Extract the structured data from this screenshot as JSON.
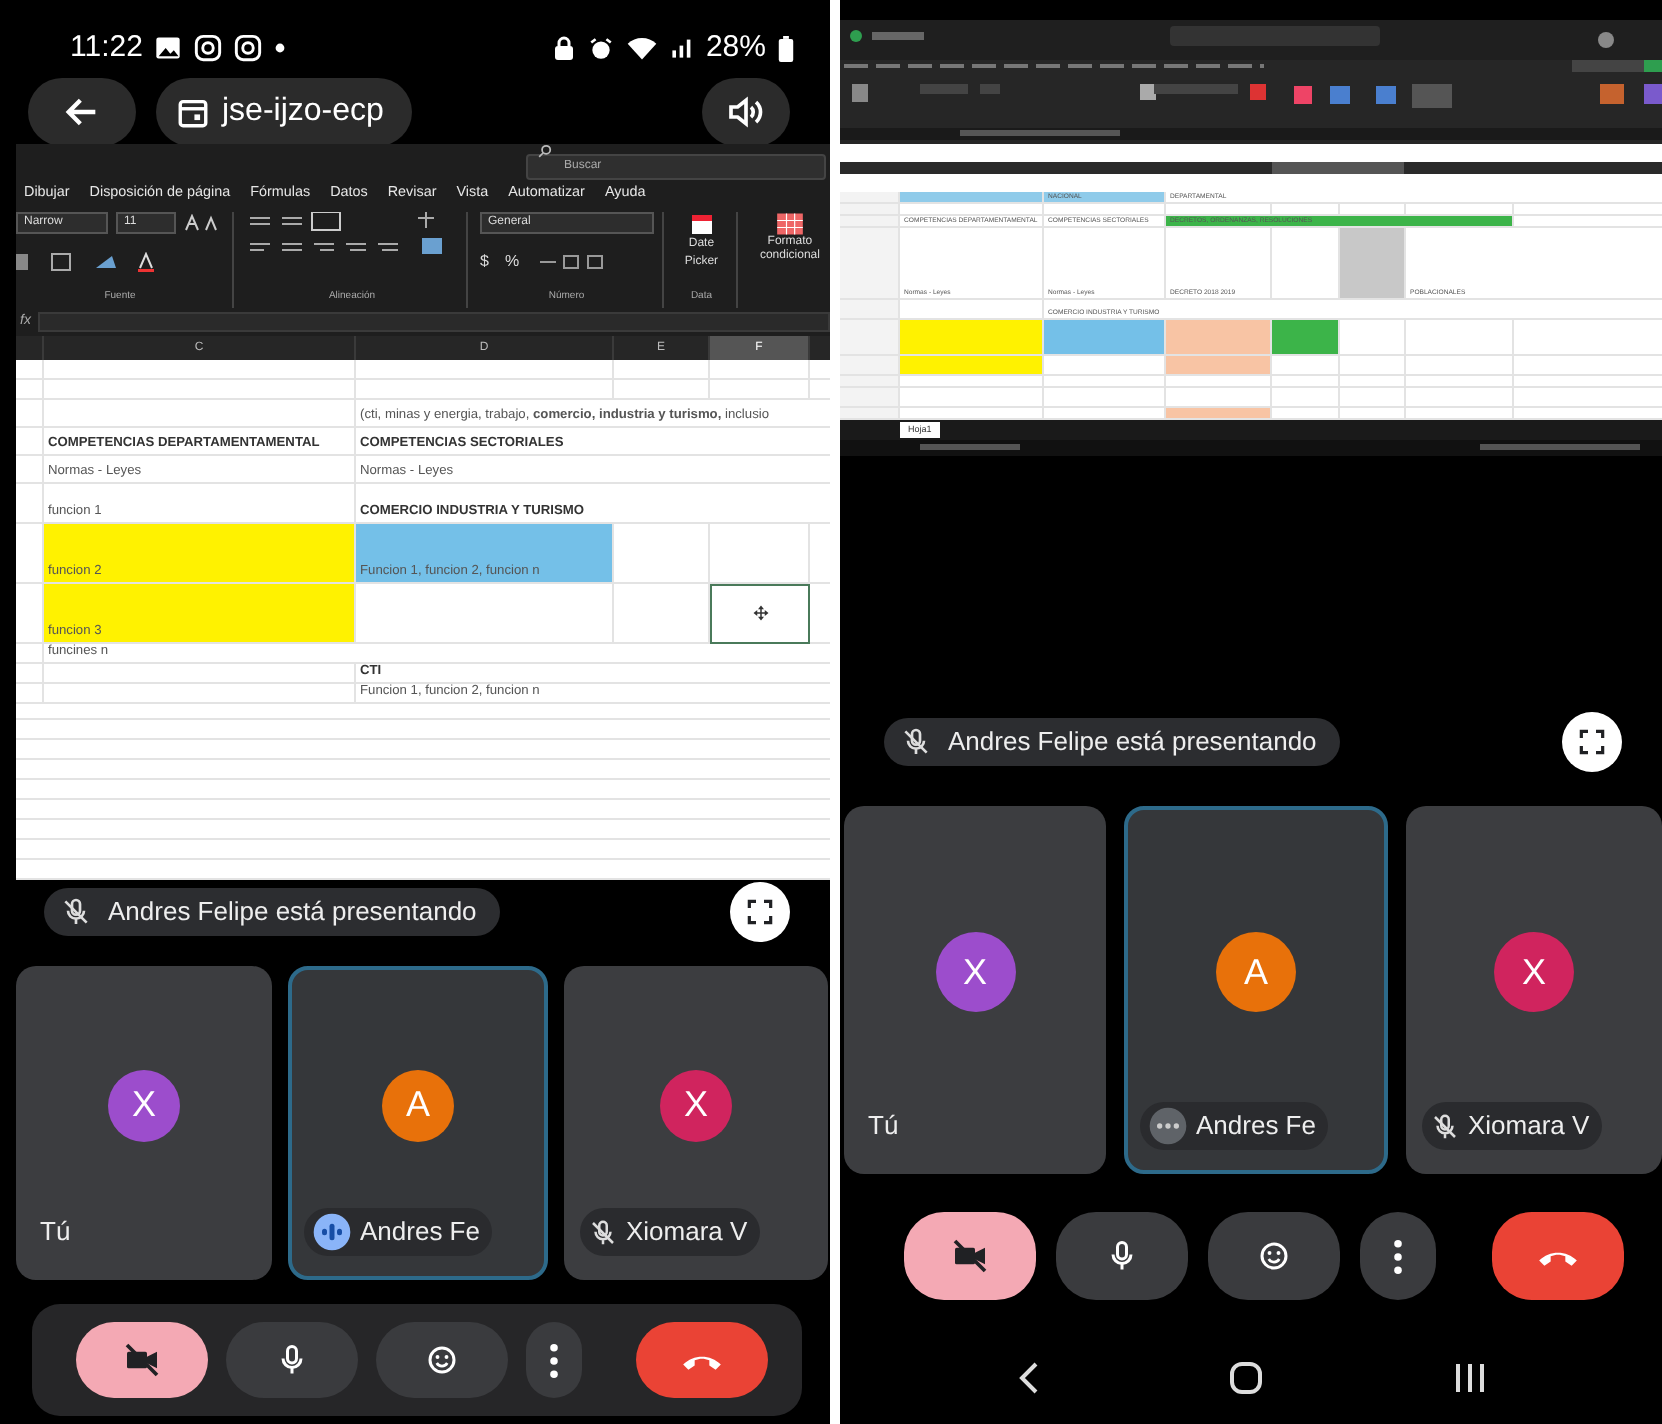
{
  "left_screen": {
    "status_bar": {
      "time": "11:22",
      "battery": "28%"
    },
    "meeting_title": "jse-ijzo-ecp",
    "excel": {
      "search": {
        "placeholder": "Buscar"
      },
      "menu": [
        "Dibujar",
        "Disposición de página",
        "Fórmulas",
        "Datos",
        "Revisar",
        "Vista",
        "Automatizar",
        "Ayuda"
      ],
      "font_name": "Narrow",
      "font_size": "11",
      "number_format": "General",
      "ribbon_symbols": [
        "$",
        "%"
      ],
      "ribbon_buttons": [
        "Date Picker",
        "Formato condicional"
      ],
      "group_labels": [
        "Fuente",
        "Alineación",
        "Número",
        "Data"
      ],
      "formula_label": "fx",
      "columns": [
        {
          "label": "C",
          "selected": false
        },
        {
          "label": "D",
          "selected": false
        },
        {
          "label": "E",
          "selected": false
        },
        {
          "label": "F",
          "selected": true
        }
      ],
      "rows": [
        {
          "kind": "short",
          "cells": [
            {
              "selected": false
            },
            {
              "selected": false
            },
            {
              "selected": false
            },
            {
              "selected": false
            }
          ]
        },
        {
          "kind": "short",
          "cells": [
            {
              "selected": false
            },
            {
              "selected": false
            },
            {
              "selected": false
            },
            {
              "selected": false
            }
          ]
        },
        {
          "kind": "normal",
          "cells": [
            {
              "selected": false
            },
            {
              "text": "(cti, minas y energia, trabajo, **comercio, industria y turismo,** inclusio",
              "bold": false,
              "selected": false
            },
            {
              "selected": false
            },
            {
              "selected": false
            }
          ]
        },
        {
          "kind": "normal",
          "cells": [
            {
              "text": "COMPETENCIAS DEPARTAMENTAMENTAL",
              "bold": true,
              "selected": false
            },
            {
              "text": "COMPETENCIAS SECTORIALES",
              "bold": true,
              "selected": false
            },
            {
              "selected": false
            },
            {
              "selected": false
            }
          ]
        },
        {
          "kind": "normal",
          "cells": [
            {
              "text": "Normas - Leyes",
              "bold": false,
              "selected": false
            },
            {
              "text": "Normas - Leyes",
              "bold": false,
              "selected": false
            },
            {
              "selected": false
            },
            {
              "selected": false
            }
          ]
        },
        {
          "kind": "tall",
          "cells": [
            {
              "text": "funcion 1",
              "bold": false,
              "selected": false
            },
            {
              "text": "COMERCIO INDUSTRIA Y TURISMO",
              "bold": true,
              "selected": false
            },
            {
              "selected": false
            },
            {
              "selected": false
            }
          ]
        },
        {
          "kind": "double",
          "cells": [
            {
              "text": "funcion 2",
              "bold": false,
              "color": "#fff200",
              "selected": false
            },
            {
              "text": "Funcion 1, funcion 2, funcion n",
              "bold": false,
              "color": "#74c0e8",
              "selected": false
            },
            {
              "selected": false
            },
            {
              "selected": false
            }
          ]
        },
        {
          "kind": "double",
          "cells": [
            {
              "text": "funcion 3",
              "bold": false,
              "color": "#fff200",
              "selected": false
            },
            {
              "selected": false
            },
            {
              "selected": false
            },
            {
              "selected": true
            }
          ]
        },
        {
          "kind": "short",
          "cells": [
            {
              "text": "funcines n",
              "bold": false,
              "selected": false
            },
            {
              "selected": false
            },
            {
              "selected": false
            },
            {
              "selected": false
            }
          ]
        },
        {
          "kind": "short",
          "cells": [
            {
              "selected": false
            },
            {
              "text": "CTI",
              "bold": true,
              "selected": false
            },
            {
              "selected": false
            },
            {
              "selected": false
            }
          ]
        },
        {
          "kind": "short",
          "cells": [
            {
              "selected": false
            },
            {
              "text": "Funcion 1, funcion 2, funcion n",
              "bold": false,
              "selected": false
            },
            {
              "selected": false
            },
            {
              "selected": false
            }
          ]
        }
      ]
    },
    "presenting": "Andres Felipe está presentando",
    "participants": [
      {
        "name": "Tú",
        "initial": "X",
        "color": "#9c4dcc",
        "highlighted": false,
        "kind": "plain"
      },
      {
        "name": "Andres Fe",
        "initial": "A",
        "color": "#e8710a",
        "highlighted": true,
        "kind": "speaking"
      },
      {
        "name": "Xiomara V",
        "initial": "X",
        "color": "#d0245e",
        "highlighted": false,
        "kind": "muted"
      }
    ],
    "controls": [
      {
        "kind": "camera",
        "on": false
      },
      {
        "kind": "mic",
        "on": true
      },
      {
        "kind": "reactions"
      },
      {
        "kind": "more"
      },
      {
        "kind": "hangup"
      }
    ]
  },
  "right_screen": {
    "sheet": {
      "tab": "Hoja1",
      "rows": [
        {
          "kind": "short",
          "cells": [
            {
              "color": "#8fcbea"
            },
            {
              "text": "NACIONAL",
              "color": "#8fcbea"
            },
            {
              "text": "DEPARTAMENTAL"
            },
            {},
            {},
            {}
          ]
        },
        {
          "kind": "short",
          "cells": [
            {},
            {},
            {},
            {},
            {},
            {}
          ]
        },
        {
          "kind": "short",
          "cells": [
            {
              "text": "COMPETENCIAS DEPARTAMENTAMENTAL"
            },
            {
              "text": "COMPETENCIAS SECTORIALES"
            },
            {
              "text": "DECRETOS, ORDENANZAS, RESOLUCIONES",
              "color": "#3cb449"
            },
            {
              "color": "#3cb449"
            },
            {
              "color": "#3cb449"
            },
            {
              "color": "#3cb449"
            }
          ]
        },
        {
          "kind": "huge",
          "cells": [
            {
              "text": "Normas - Leyes"
            },
            {
              "text": "Normas - Leyes"
            },
            {
              "text": "DECRETO 2018 2019"
            },
            {
              "color": "#ffffff"
            },
            {
              "color": "#c8c8c8"
            },
            {
              "text": "POBLACIONALES"
            }
          ]
        },
        {
          "kind": "normal",
          "cells": [
            {},
            {
              "text": "COMERCIO INDUSTRIA Y TURISMO"
            },
            {},
            {},
            {},
            {}
          ]
        },
        {
          "kind": "tall",
          "cells": [
            {
              "color": "#fff200"
            },
            {
              "color": "#74c0e8"
            },
            {
              "color": "#f8c4a4"
            },
            {
              "color": "#3cb449"
            },
            {},
            {}
          ]
        },
        {
          "kind": "normal",
          "cells": [
            {
              "color": "#fff200"
            },
            {},
            {
              "color": "#f8c4a4"
            },
            {},
            {},
            {}
          ]
        },
        {
          "kind": "short",
          "cells": [
            {},
            {},
            {},
            {},
            {},
            {}
          ]
        },
        {
          "kind": "normal",
          "cells": [
            {},
            {},
            {},
            {},
            {},
            {}
          ]
        },
        {
          "kind": "short",
          "cells": [
            {},
            {},
            {
              "color": "#f8c4a4"
            },
            {},
            {},
            {}
          ]
        }
      ]
    },
    "presenting": "Andres Felipe está presentando",
    "participants": [
      {
        "name": "Tú",
        "initial": "X",
        "color": "#9c4dcc",
        "highlighted": false,
        "kind": "plain"
      },
      {
        "name": "Andres Fe",
        "initial": "A",
        "color": "#e8710a",
        "highlighted": true,
        "kind": "idle"
      },
      {
        "name": "Xiomara V",
        "initial": "X",
        "color": "#d0245e",
        "highlighted": false,
        "kind": "muted"
      }
    ],
    "controls": [
      {
        "kind": "camera",
        "on": false
      },
      {
        "kind": "mic",
        "on": true
      },
      {
        "kind": "reactions"
      },
      {
        "kind": "more"
      },
      {
        "kind": "hangup"
      }
    ],
    "nav": [
      {
        "kind": "back"
      },
      {
        "kind": "home"
      },
      {
        "kind": "recents"
      }
    ]
  }
}
